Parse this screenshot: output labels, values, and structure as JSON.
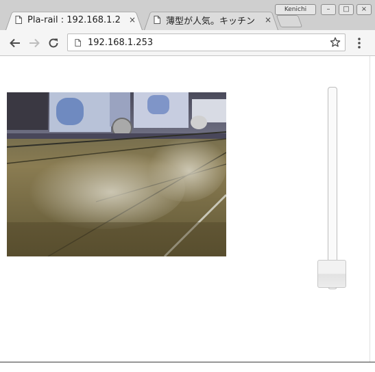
{
  "browser": {
    "tabs": [
      {
        "title": "Pla-rail : 192.168.1.2",
        "close": "×",
        "active": true
      },
      {
        "title": "薄型が人気。キッチン",
        "close": "×",
        "active": false
      }
    ],
    "profile_name": "Kenichi",
    "window_controls": {
      "minimize": "–",
      "maximize": "□",
      "close": "×"
    },
    "address": "192.168.1.253",
    "icons": {
      "back": "back-arrow-icon",
      "forward": "forward-arrow-icon",
      "reload": "reload-icon",
      "page": "page-icon",
      "bookmark": "star-icon",
      "menu": "kebab-menu-icon"
    }
  },
  "page": {
    "camera_feed": "camera-view",
    "speed_slider": {
      "value": 0.05,
      "orientation": "vertical"
    }
  },
  "colors": {
    "tabstrip": "#cfcfcf",
    "toolbar": "#f5f5f5"
  }
}
